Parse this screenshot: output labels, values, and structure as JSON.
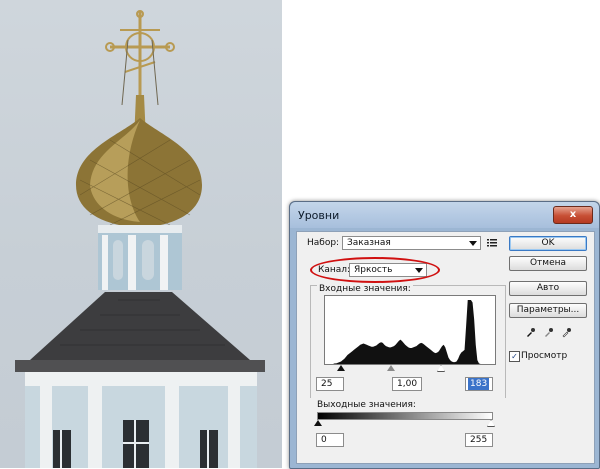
{
  "dialog": {
    "title": "Уровни",
    "close_label": "x",
    "preset_label": "Набор:",
    "preset_value": "Заказная",
    "preset_menu_icon": "menu-lines-icon",
    "channel_label": "Канал:",
    "channel_value": "Яркость",
    "input_levels_label": "Входные значения:",
    "input_black": "25",
    "input_gamma": "1,00",
    "input_white": "183",
    "output_levels_label": "Выходные значения:",
    "output_black": "0",
    "output_white": "255",
    "buttons": {
      "ok": "OK",
      "cancel": "Отмена",
      "auto": "Авто",
      "options": "Параметры..."
    },
    "preview_label": "Просмотр",
    "preview_checked": true,
    "checkmark": "✓",
    "highlight_color": "#d01010",
    "accent_color": "#3b73c9"
  },
  "histogram": {
    "levels": [
      0,
      0,
      0,
      0,
      0,
      0,
      1,
      1,
      2,
      3,
      4,
      6,
      8,
      11,
      14,
      16,
      18,
      20,
      22,
      24,
      26,
      28,
      30,
      31,
      32,
      31,
      30,
      29,
      28,
      27,
      27,
      28,
      29,
      31,
      33,
      34,
      33,
      30,
      28,
      27,
      26,
      26,
      27,
      28,
      30,
      33,
      36,
      38,
      36,
      33,
      30,
      28,
      26,
      25,
      25,
      26,
      27,
      28,
      30,
      32,
      33,
      32,
      30,
      28,
      26,
      24,
      22,
      20,
      18,
      17,
      18,
      20,
      24,
      28,
      30,
      26,
      18,
      10,
      6,
      4,
      3,
      3,
      4,
      8,
      14,
      18,
      20,
      22,
      60,
      100,
      100,
      100,
      96,
      70,
      30,
      6,
      1,
      0,
      0,
      0,
      0,
      0,
      0,
      0,
      0,
      0
    ]
  }
}
